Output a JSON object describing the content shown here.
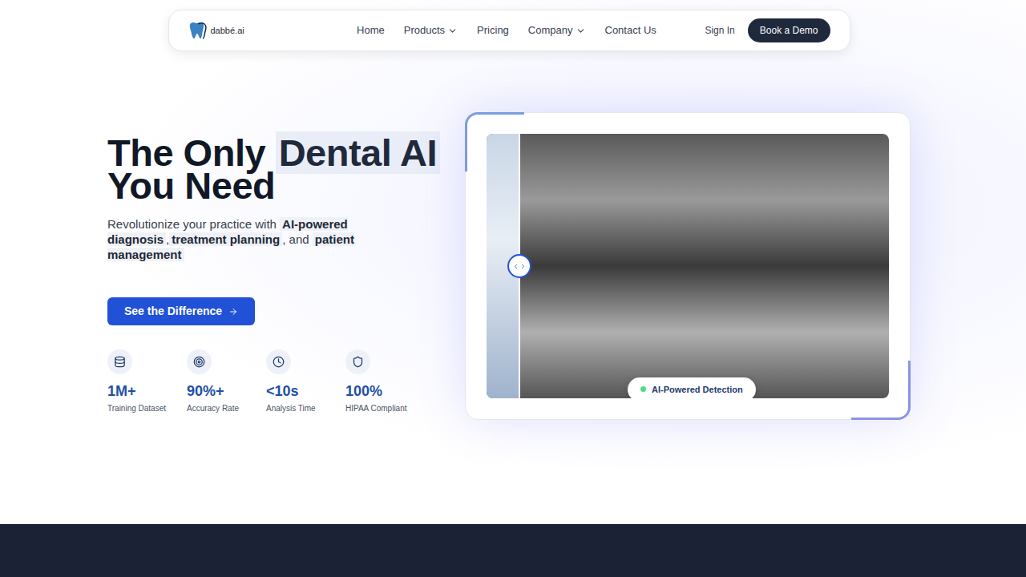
{
  "nav": {
    "logo": "dabbé.ai",
    "links": [
      {
        "label": "Home",
        "dropdown": false
      },
      {
        "label": "Products",
        "dropdown": true
      },
      {
        "label": "Pricing",
        "dropdown": false
      },
      {
        "label": "Company",
        "dropdown": true
      },
      {
        "label": "Contact Us",
        "dropdown": false
      }
    ],
    "sign_in": "Sign In",
    "cta": "Book a Demo"
  },
  "hero": {
    "title_before": "The Only ",
    "title_highlight": "Dental AI",
    "title_after": "You Need",
    "subtitle": [
      {
        "text": "Revolutionize your practice with ",
        "highlight": false
      },
      {
        "text": "AI-powered diagnosis",
        "highlight": true
      },
      {
        "text": ",",
        "highlight": false
      },
      {
        "text": "treatment planning",
        "highlight": true
      },
      {
        "text": ", and ",
        "highlight": false
      },
      {
        "text": "patient management",
        "highlight": true
      }
    ],
    "button": "See the Difference",
    "stats": [
      {
        "value": "1M+",
        "label": "Training Dataset",
        "icon": "database"
      },
      {
        "value": "90%+",
        "label": "Accuracy Rate",
        "icon": "target"
      },
      {
        "value": "<10s",
        "label": "Analysis Time",
        "icon": "clock"
      },
      {
        "value": "100%",
        "label": "HIPAA Compliant",
        "icon": "shield"
      }
    ]
  },
  "comparison": {
    "level": 0.08,
    "badge": "AI-Powered Detection"
  }
}
